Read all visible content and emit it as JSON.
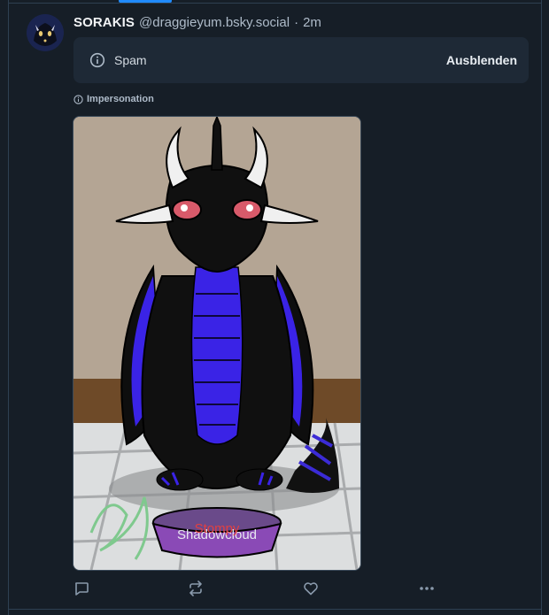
{
  "post": {
    "author_name": "SORAKIS",
    "author_handle": "@draggieyum.bsky.social",
    "separator": "·",
    "time": "2m"
  },
  "moderation": {
    "label": "Spam",
    "hide_label": "Ausblenden",
    "sub_label": "Impersonation"
  },
  "image": {
    "bowl_text_top": "Stompy",
    "bowl_text_bottom": "Shadowcloud"
  },
  "colors": {
    "background": "#161e27",
    "card": "#1e2936",
    "accent": "#208bfe",
    "muted": "#aebbc9"
  },
  "actions": {
    "icons": [
      "reply-icon",
      "repost-icon",
      "like-icon",
      "more-icon"
    ]
  }
}
